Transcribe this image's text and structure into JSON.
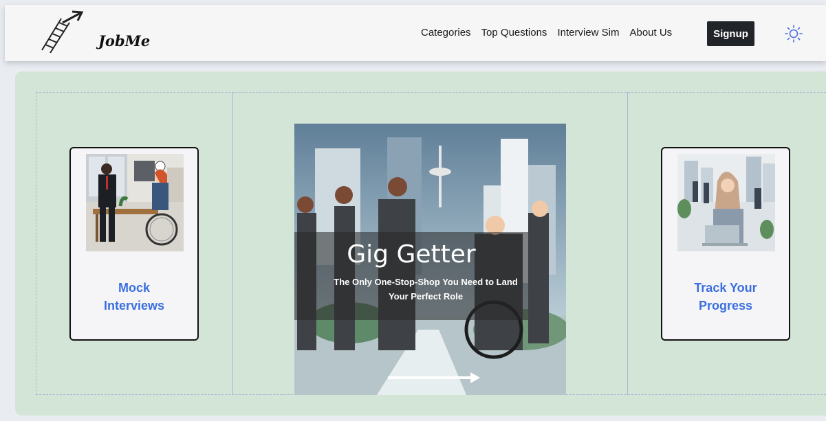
{
  "header": {
    "brand": "JobMe",
    "nav": [
      "Categories",
      "Top Questions",
      "Interview Sim",
      "About Us"
    ],
    "signup_label": "Signup",
    "theme_icon": "sun-icon"
  },
  "hero": {
    "left_card": {
      "label": "Mock\nInterviews",
      "image": "interview-illustration"
    },
    "center": {
      "title": "Gig Getter",
      "subtitle": "The Only One-Stop-Shop You Need to Land\nYour Perfect Role",
      "image": "professionals-city-illustration"
    },
    "right_card": {
      "label": "Track Your\nProgress",
      "image": "laptop-worker-illustration"
    }
  },
  "colors": {
    "hero_bg": "#d3e5d6",
    "link_blue": "#3a6fe0",
    "signup_bg": "#212529"
  }
}
